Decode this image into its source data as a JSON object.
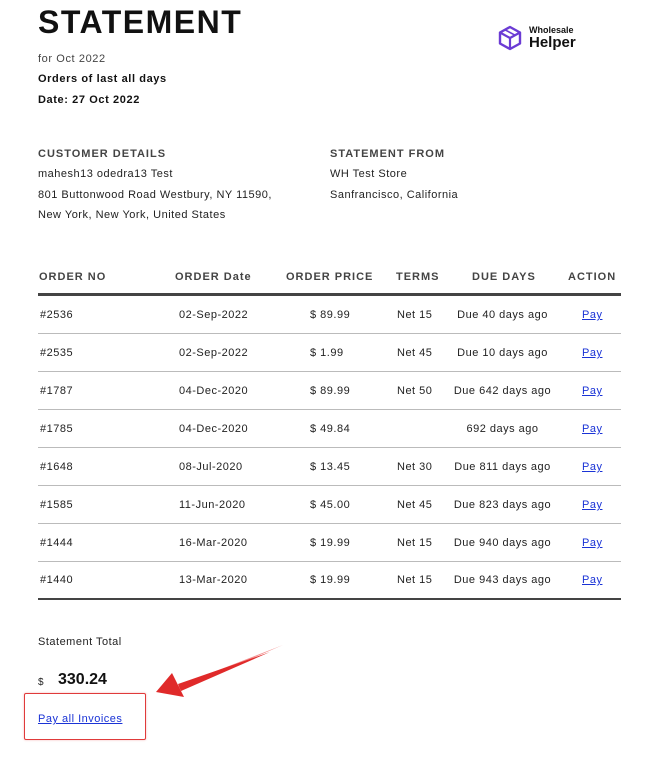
{
  "title": "STATEMENT",
  "period": "for Oct 2022",
  "orders_scope": "Orders of last all days",
  "date": "Date: 27 Oct 2022",
  "logo": {
    "small": "Wholesale",
    "big": "Helper",
    "icon": "cube-icon",
    "color": "#6b3bd4"
  },
  "customer": {
    "heading": "CUSTOMER DETAILS",
    "name": "mahesh13 odedra13 Test",
    "line1": "801 Buttonwood Road Westbury, NY 11590,",
    "line2": "New York, New York, United States"
  },
  "from": {
    "heading": "STATEMENT FROM",
    "store": "WH Test Store",
    "city": "Sanfrancisco, California"
  },
  "table": {
    "headers": {
      "order_no": "ORDER NO",
      "order_date": "ORDER Date",
      "order_price": "ORDER PRICE",
      "terms": "TERMS",
      "due_days": "DUE DAYS",
      "action": "ACTION"
    },
    "rows": [
      {
        "no": "#2536",
        "date": "02-Sep-2022",
        "price": "$ 89.99",
        "terms": "Net 15",
        "due": "Due 40 days ago",
        "action": "Pay"
      },
      {
        "no": "#2535",
        "date": "02-Sep-2022",
        "price": "$ 1.99",
        "terms": "Net 45",
        "due": "Due 10 days ago",
        "action": "Pay"
      },
      {
        "no": "#1787",
        "date": "04-Dec-2020",
        "price": "$ 89.99",
        "terms": "Net 50",
        "due": "Due 642 days ago",
        "action": "Pay"
      },
      {
        "no": "#1785",
        "date": "04-Dec-2020",
        "price": "$ 49.84",
        "terms": "",
        "due": "692 days ago",
        "action": "Pay"
      },
      {
        "no": "#1648",
        "date": "08-Jul-2020",
        "price": "$ 13.45",
        "terms": "Net 30",
        "due": "Due 811 days ago",
        "action": "Pay"
      },
      {
        "no": "#1585",
        "date": "11-Jun-2020",
        "price": "$ 45.00",
        "terms": "Net 45",
        "due": "Due 823 days ago",
        "action": "Pay"
      },
      {
        "no": "#1444",
        "date": "16-Mar-2020",
        "price": "$ 19.99",
        "terms": "Net 15",
        "due": "Due 940 days ago",
        "action": "Pay"
      },
      {
        "no": "#1440",
        "date": "13-Mar-2020",
        "price": "$ 19.99",
        "terms": "Net 15",
        "due": "Due 943 days ago",
        "action": "Pay"
      }
    ]
  },
  "total": {
    "label": "Statement Total",
    "currency": "$",
    "amount": "330.24"
  },
  "pay_all": "Pay all Invoices",
  "colors": {
    "link": "#1a33d6",
    "highlight": "#e03a3a"
  }
}
